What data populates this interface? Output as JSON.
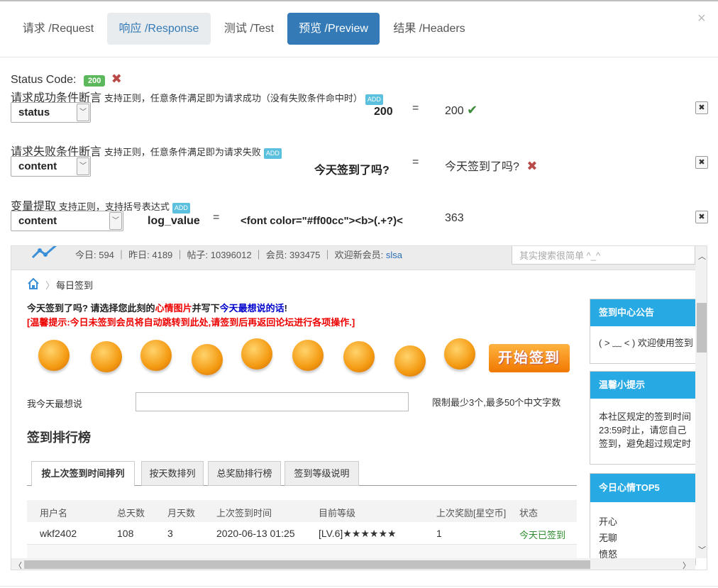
{
  "tabs": [
    {
      "label": "请求 /Request"
    },
    {
      "label": "响应 /Response"
    },
    {
      "label": "测试 /Test"
    },
    {
      "label": "预览 /Preview"
    },
    {
      "label": "结果 /Headers"
    }
  ],
  "close_symbol": "×",
  "status": {
    "label": "Status Code:",
    "code": "200"
  },
  "success_assert": {
    "title": "请求成功条件断言",
    "hint": "支持正则，任意条件满足即为请求成功（没有失败条件命中时）",
    "add": "ADD",
    "field": "status",
    "expected": "200",
    "op": "=",
    "actual": "200"
  },
  "fail_assert": {
    "title": "请求失败条件断言",
    "hint": "支持正则，任意条件满足即为请求失败",
    "add": "ADD",
    "field": "content",
    "expected": "今天签到了吗?",
    "op": "=",
    "actual": "今天签到了吗?"
  },
  "var_extract": {
    "title": "变量提取",
    "hint": "支持正则，支持括号表达式",
    "add": "ADD",
    "field": "content",
    "var_name": "log_value",
    "op": "=",
    "expr": "<font color=\"#ff00cc\"><b>(.+?)<",
    "value": "363"
  },
  "remove_symbol": "✖",
  "preview": {
    "stats": "今日: 594 ｜ 昨日: 4189 ｜ 帖子: 10396012 ｜ 会员: 393475 ｜ 欢迎新会员:",
    "new_member": "slsa",
    "search_placeholder": "其实搜索很简单 ^_^",
    "breadcrumb": "每日签到",
    "question_a": "今天签到了吗? 请选择您此刻的",
    "question_b": "心情图片",
    "question_c": "并写下",
    "question_d": "今天最想说的话",
    "question_e": "!",
    "warning": "[温馨提示:今日未签到会员将自动跳转到此处,请签到后再返回论坛进行各项操作.]",
    "sign_button": "开始签到",
    "say_label": "我今天最想说",
    "say_limit": "限制最少3个,最多50个中文字数",
    "rank_title": "签到排行榜",
    "rank_tabs": [
      "按上次签到时间排列",
      "按天数排列",
      "总奖励排行榜",
      "签到等级说明"
    ],
    "table_headers": [
      "用户名",
      "总天数",
      "月天数",
      "上次签到时间",
      "目前等级",
      "上次奖励[星空币]",
      "状态"
    ],
    "table_row": [
      "wkf2402",
      "108",
      "3",
      "2020-06-13 01:25",
      "[LV.6]★★★★★★",
      "1",
      "今天已签到"
    ],
    "notice_title": "签到中心公告",
    "notice_body": "( > ﹏ < ) 欢迎使用签到",
    "tips_title": "温馨小提示",
    "tips_body": [
      "本社区规定的签到时间",
      "23:59时止，请您自己",
      "签到，避免超过规定时"
    ],
    "mood_title": "今日心情TOP5",
    "mood_list": [
      "开心",
      "无聊",
      "愤怒"
    ]
  }
}
